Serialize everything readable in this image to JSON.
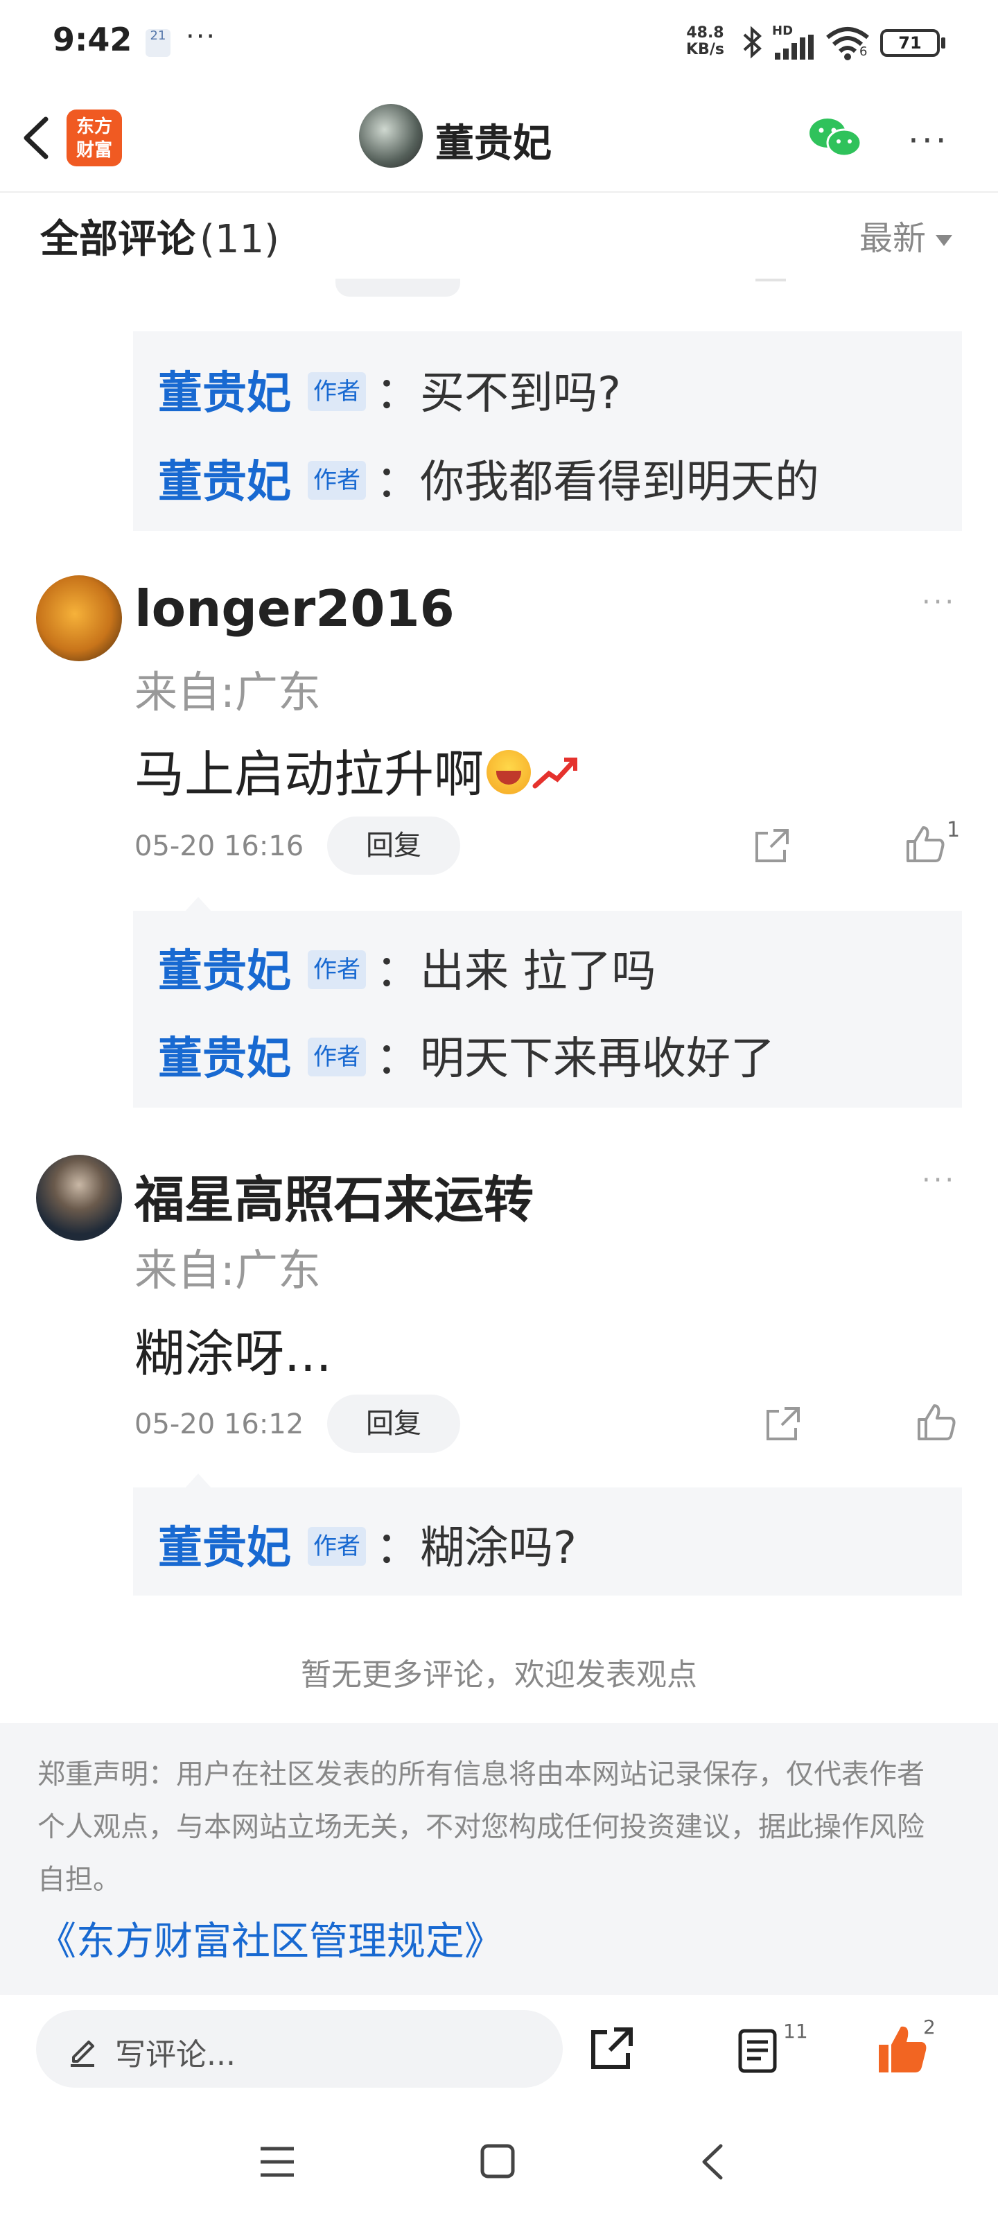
{
  "status_bar": {
    "time": "9:42",
    "calendar_badge": "21",
    "speed_value": "48.8",
    "speed_unit": "KB/s",
    "network_label": "HD",
    "wifi_badge": "6",
    "battery": "71"
  },
  "nav": {
    "logo_line1": "东方",
    "logo_line2": "财富",
    "title": "董贵妃"
  },
  "comments_header": {
    "title": "全部评论",
    "count": "(11)",
    "sort": "最新"
  },
  "thread0_replies": [
    {
      "name": "董贵妃",
      "tag": "作者",
      "text": "：买不到吗?"
    },
    {
      "name": "董贵妃",
      "tag": "作者",
      "text": "：你我都看得到明天的"
    }
  ],
  "comments": [
    {
      "user": "longer2016",
      "from": "来自:广东",
      "text": "马上启动拉升啊",
      "date": "05-20 16:16",
      "reply_label": "回复",
      "likes": "1",
      "replies": [
        {
          "name": "董贵妃",
          "tag": "作者",
          "text": "：出来 拉了吗"
        },
        {
          "name": "董贵妃",
          "tag": "作者",
          "text": "：明天下来再收好了"
        }
      ]
    },
    {
      "user": "福星高照石来运转",
      "from": "来自:广东",
      "text": "糊涂呀...",
      "date": "05-20 16:12",
      "reply_label": "回复",
      "replies": [
        {
          "name": "董贵妃",
          "tag": "作者",
          "text": "：糊涂吗?"
        }
      ]
    }
  ],
  "footer": {
    "no_more": "暂无更多评论，欢迎发表观点",
    "disclaimer_lines": [
      "郑重声明：用户在社区发表的所有信息将由本网站记录保存，仅代表作者",
      "个人观点，与本网站立场无关，不对您构成任何投资建议，据此操作风险",
      "自担。"
    ],
    "rules_link": "《东方财富社区管理规定》"
  },
  "bottom_bar": {
    "write_placeholder": "写评论...",
    "comment_count": "11",
    "like_count": "2"
  },
  "colors": {
    "accent_blue": "#1869d1",
    "brand_orange": "#f05a22",
    "like_orange": "#f26522"
  }
}
